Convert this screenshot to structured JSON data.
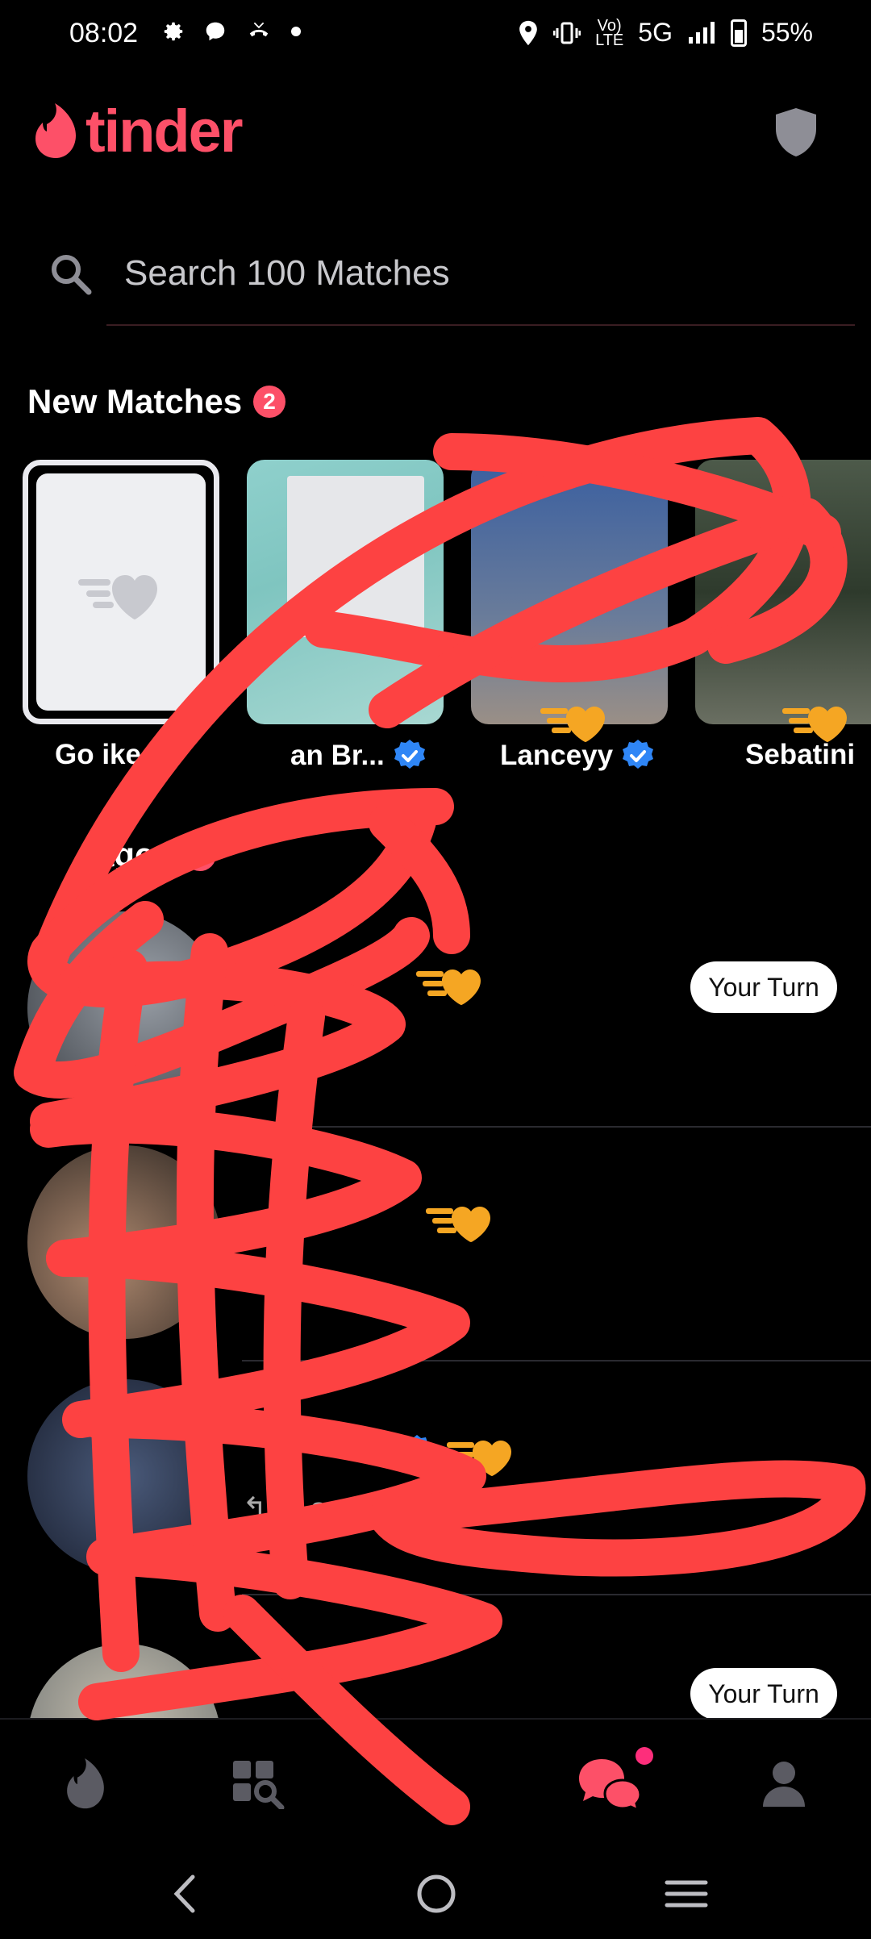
{
  "status_bar": {
    "time": "08:02",
    "network": "5G",
    "battery": "55%",
    "icons": [
      "gear-icon",
      "chat-bubble-icon",
      "missed-call-icon",
      "dot-icon",
      "location-icon",
      "vibrate-icon",
      "volte-icon",
      "signal-icon",
      "battery-icon"
    ]
  },
  "header": {
    "brand": "tinder",
    "brand_color": "#fd5068"
  },
  "search": {
    "placeholder": "Search 100 Matches"
  },
  "new_matches": {
    "title": "New Matches",
    "count": "2",
    "items": [
      {
        "name": "Go  ikes",
        "verified": false
      },
      {
        "name": "an Br...",
        "verified": true
      },
      {
        "name": "Lanceyy",
        "verified": true
      },
      {
        "name": "Sebatini",
        "verified": false
      }
    ]
  },
  "messages": {
    "title": "ages",
    "count": "2",
    "rows": [
      {
        "snippet": "",
        "action": "Your Turn"
      },
      {
        "snippet": "↰",
        "action": ""
      },
      {
        "snippet": "↰ha   a st",
        "action": ""
      },
      {
        "snippet": "",
        "action": "Your Turn"
      }
    ]
  },
  "bottom_nav": {
    "items": [
      "flame-icon",
      "explore-icon",
      "",
      "chat-icon",
      "profile-icon"
    ],
    "active": "chat-icon",
    "active_color": "#fd5068"
  },
  "system_nav": [
    "back-icon",
    "home-icon",
    "recents-icon"
  ]
}
